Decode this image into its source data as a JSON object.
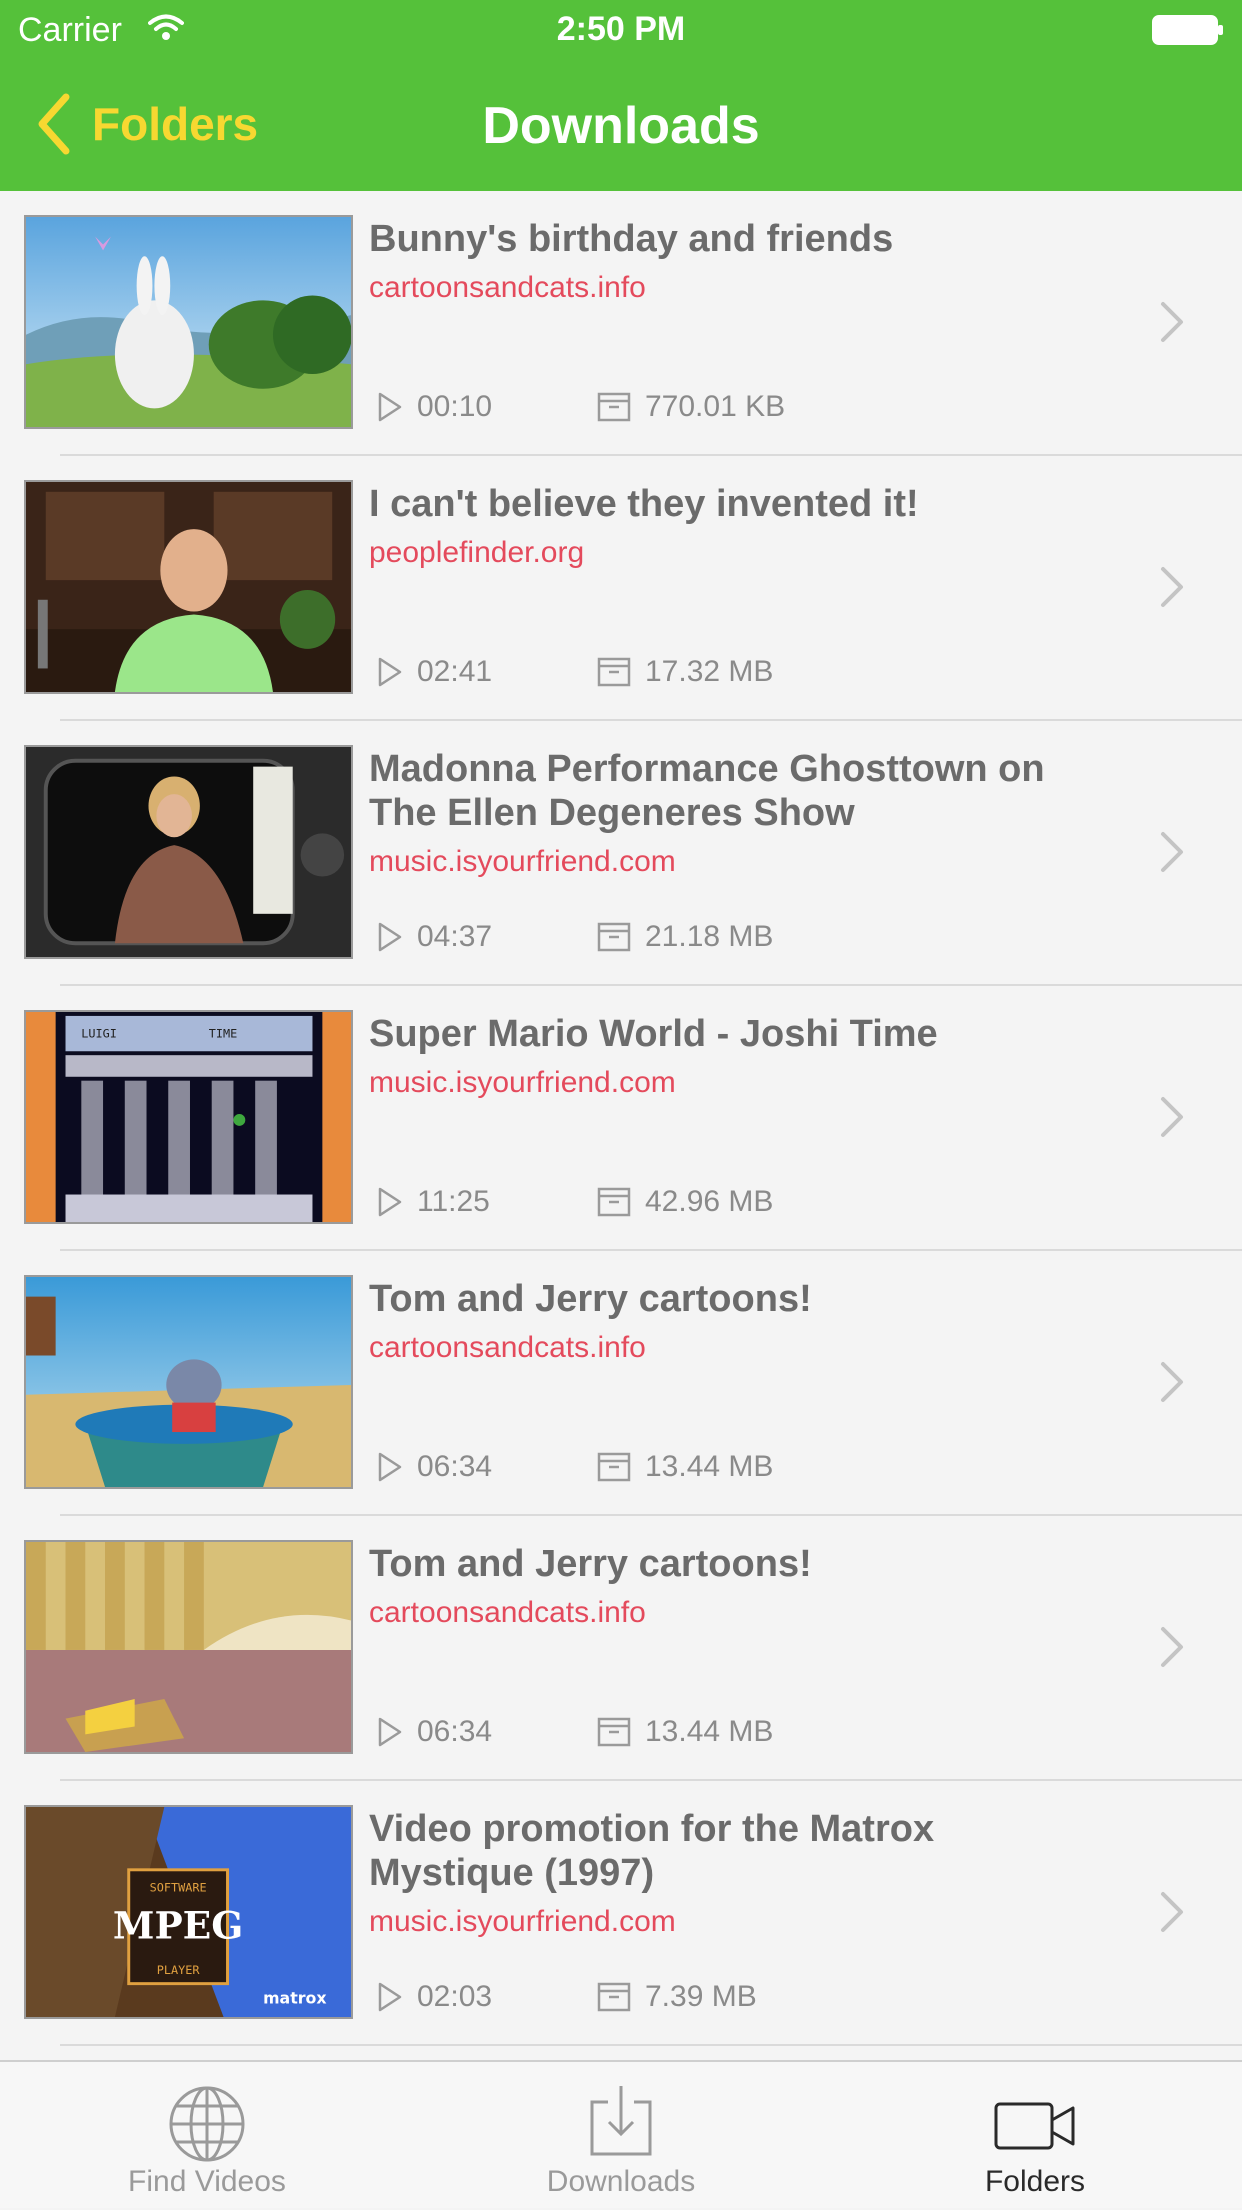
{
  "status_bar": {
    "carrier": "Carrier",
    "time": "2:50 PM"
  },
  "nav": {
    "back_label": "Folders",
    "title": "Downloads"
  },
  "colors": {
    "header_green": "#55c13a",
    "back_yellow": "#f7d831",
    "source_red": "#e44a5c"
  },
  "videos": [
    {
      "title": "Bunny's birthday and friends",
      "source": "cartoonsandcats.info",
      "duration": "00:10",
      "size": "770.01 KB"
    },
    {
      "title": "I can't believe they invented it!",
      "source": "peoplefinder.org",
      "duration": "02:41",
      "size": "17.32 MB"
    },
    {
      "title": "Madonna Performance Ghosttown on The Ellen Degeneres Show",
      "source": "music.isyourfriend.com",
      "duration": "04:37",
      "size": "21.18 MB"
    },
    {
      "title": "Super Mario World - Joshi Time",
      "source": "music.isyourfriend.com",
      "duration": "11:25",
      "size": "42.96 MB"
    },
    {
      "title": "Tom and Jerry cartoons!",
      "source": "cartoonsandcats.info",
      "duration": "06:34",
      "size": "13.44 MB"
    },
    {
      "title": "Tom and Jerry cartoons!",
      "source": "cartoonsandcats.info",
      "duration": "06:34",
      "size": "13.44 MB"
    },
    {
      "title": "Video promotion for the Matrox Mystique (1997)",
      "source": "music.isyourfriend.com",
      "duration": "02:03",
      "size": "7.39 MB"
    }
  ],
  "tabs": [
    {
      "label": "Find Videos",
      "icon": "globe-icon"
    },
    {
      "label": "Downloads",
      "icon": "download-tray-icon"
    },
    {
      "label": "Folders",
      "icon": "video-camera-icon"
    }
  ],
  "thumbnail_art": {
    "mario_hud": "LUIGI",
    "mario_time": "TIME",
    "mpeg_badge": "MPEG",
    "mpeg_top": "SOFTWARE",
    "mpeg_bottom": "PLAYER",
    "matrox_logo": "matrox"
  }
}
